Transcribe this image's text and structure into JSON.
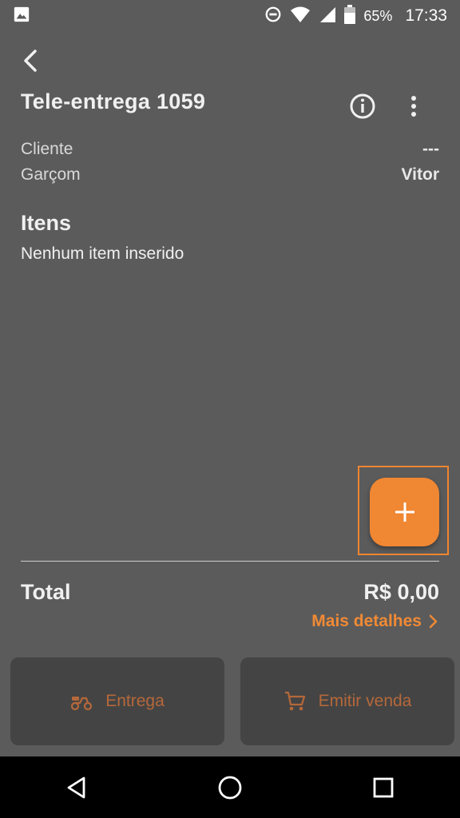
{
  "status_bar": {
    "battery_percent": "65%",
    "time": "17:33",
    "icons": [
      "image-icon",
      "do-not-disturb-icon",
      "wifi-icon",
      "signal-icon",
      "battery-icon"
    ]
  },
  "header": {
    "title": "Tele-entrega 1059",
    "icons": [
      "back-arrow-icon",
      "info-icon",
      "more-vert-icon"
    ]
  },
  "details": {
    "client_label": "Cliente",
    "client_value": "---",
    "waiter_label": "Garçom",
    "waiter_value": "Vitor"
  },
  "items": {
    "title": "Itens",
    "empty_message": "Nenhum item inserido"
  },
  "fab": {
    "icon": "plus-icon"
  },
  "summary": {
    "total_label": "Total",
    "total_value": "R$ 0,00",
    "details_link": "Mais detalhes"
  },
  "actions": {
    "delivery_label": "Entrega",
    "delivery_icon": "scooter-icon",
    "sale_label": "Emitir venda",
    "sale_icon": "cart-icon"
  },
  "navigation_bar": {
    "icons": [
      "back-triangle-icon",
      "home-circle-icon",
      "recents-square-icon"
    ]
  },
  "colors": {
    "background": "#5b5b5b",
    "accent": "#f08733",
    "button_bg": "#444444",
    "disabled_accent": "#b5683a",
    "navbar": "#000000"
  }
}
